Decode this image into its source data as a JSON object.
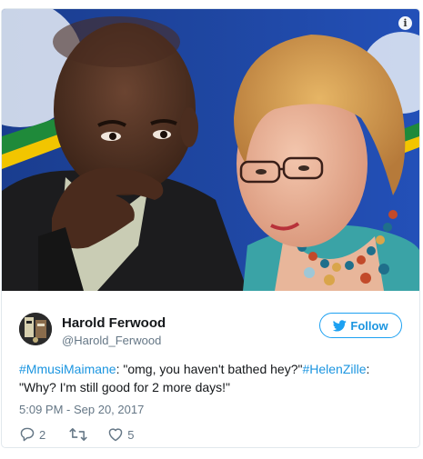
{
  "tweet": {
    "user": {
      "name": "Harold Ferwood",
      "handle": "@Harold_Ferwood"
    },
    "follow_label": "Follow",
    "text": {
      "hashtag1": "#MmusiMaimane",
      "part1": ": \"omg, you haven't bathed hey?\"",
      "hashtag2": "#HelenZille",
      "part2": ": \"Why? I'm still good for 2 more days!\""
    },
    "timestamp": "5:09 PM - Sep 20, 2017",
    "actions": {
      "replies": "2",
      "likes": "5"
    }
  },
  "media": {
    "info_icon": "info-icon"
  },
  "colors": {
    "accent": "#1da1f2",
    "link": "#1b95e0",
    "muted": "#657786",
    "border": "#e1e8ed"
  }
}
